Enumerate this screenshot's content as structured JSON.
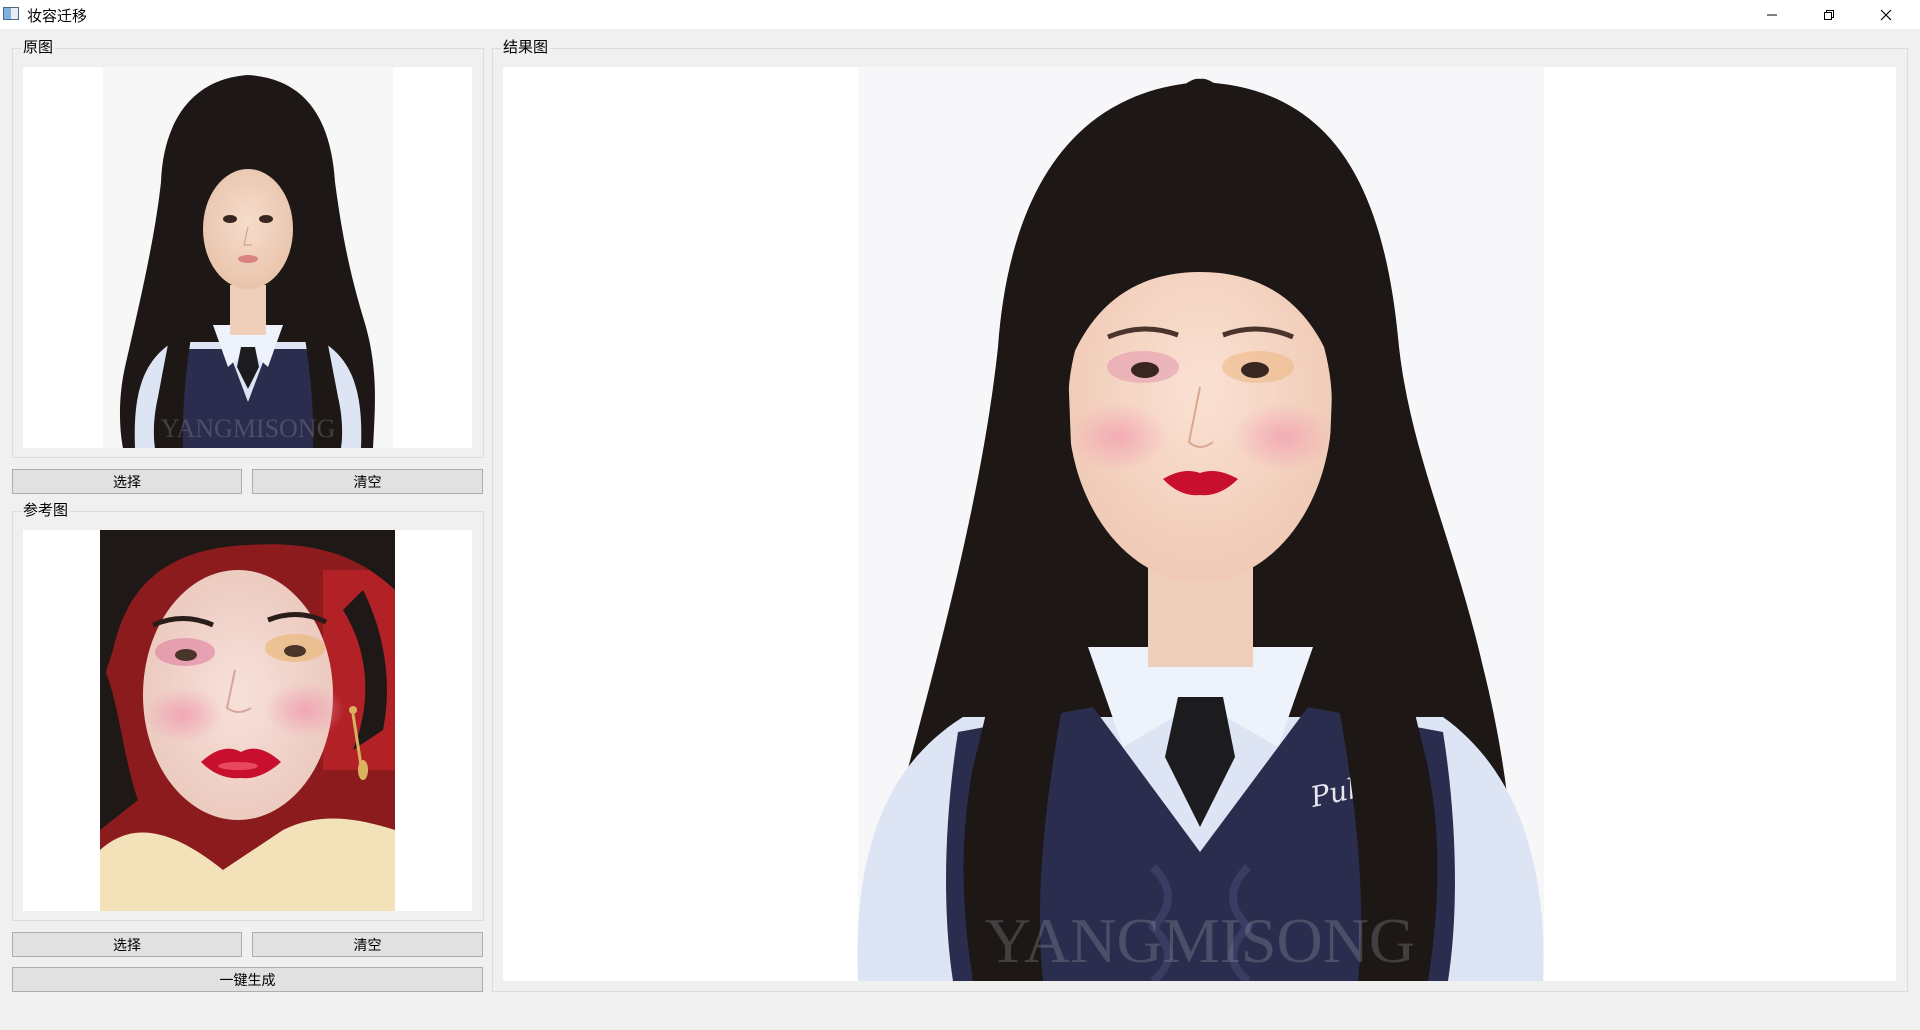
{
  "window": {
    "title": "妆容迁移",
    "controls": [
      "minimize",
      "restore",
      "close"
    ]
  },
  "source_panel": {
    "title": "原图",
    "image": "photo of a young woman with long dark hair, white collared shirt, black tie and navy cable-knit vest",
    "image_watermark": "YANGMISONG",
    "select_label": "选择",
    "clear_label": "清空"
  },
  "reference_panel": {
    "title": "参考图",
    "image": "close-up photo of a woman with pink eye makeup and glossy red lips, red background, cream shirt, dangling earrings",
    "select_label": "选择",
    "clear_label": "清空"
  },
  "generate_label": "一键生成",
  "result_panel": {
    "title": "结果图",
    "image": "enlarged result: the young woman with makeup transferred (pink eyeshadow, blush, red lips)",
    "image_watermark": "YANGMISONG"
  },
  "colors": {
    "window_bg": "#f0f0f0",
    "titlebar_bg": "#ffffff",
    "image_bg": "#ffffff",
    "button_bg": "#e1e1e1",
    "button_border": "#adadad",
    "vest": "#2b2d4e",
    "shirt": "#dde5f5",
    "hair": "#1d1716",
    "lip_red": "#c8102e"
  }
}
